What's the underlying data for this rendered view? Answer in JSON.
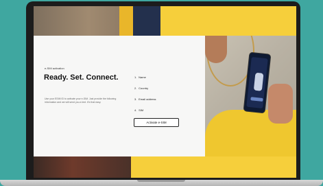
{
  "hero": {
    "eyebrow": "e-SIM activation",
    "headline": "Ready. Set. Connect.",
    "body": "Use your ESIM ID to activate your e-SIM. Just provide the following information and we will send you a text. It's that easy."
  },
  "steps": [
    {
      "num": "1.",
      "label": "Name"
    },
    {
      "num": "2.",
      "label": "Country"
    },
    {
      "num": "3.",
      "label": "Email address"
    },
    {
      "num": "4.",
      "label": "SIM"
    }
  ],
  "cta": {
    "label": "Activate e-SIM"
  },
  "colors": {
    "background": "#3fa7a0",
    "accent_yellow": "#f6cf3b",
    "panel": "#f7f7f6",
    "text": "#111111"
  }
}
